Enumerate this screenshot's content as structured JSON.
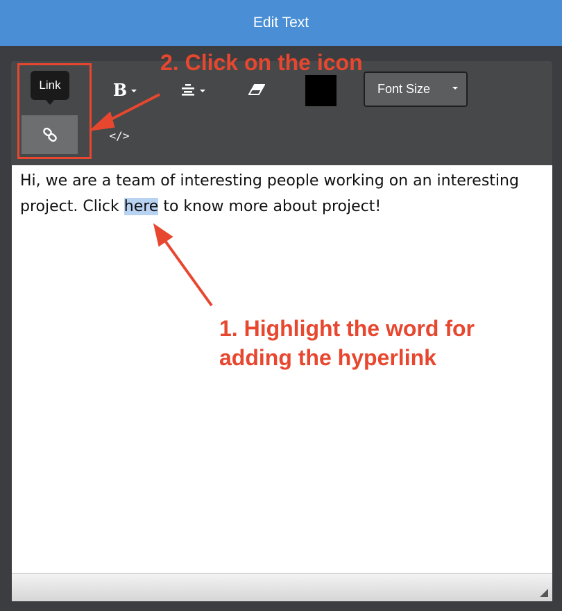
{
  "window": {
    "title": "Edit Text"
  },
  "toolbar": {
    "tooltip": "Link",
    "code_label": "</>",
    "font_size_label": "Font Size",
    "text_color": "#000000"
  },
  "editor": {
    "text_before": "Hi, we are a team of interesting people working on an interesting project. Click ",
    "selected_word": "here",
    "text_after": " to know more about project!"
  },
  "annotations": {
    "step2": "2. Click on the icon",
    "step1_line1": "1. Highlight the word for",
    "step1_line2": "adding the hyperlink",
    "color": "#e8472f"
  },
  "icons": [
    "link-icon",
    "bold-icon",
    "align-icon",
    "eraser-icon",
    "code-icon"
  ]
}
